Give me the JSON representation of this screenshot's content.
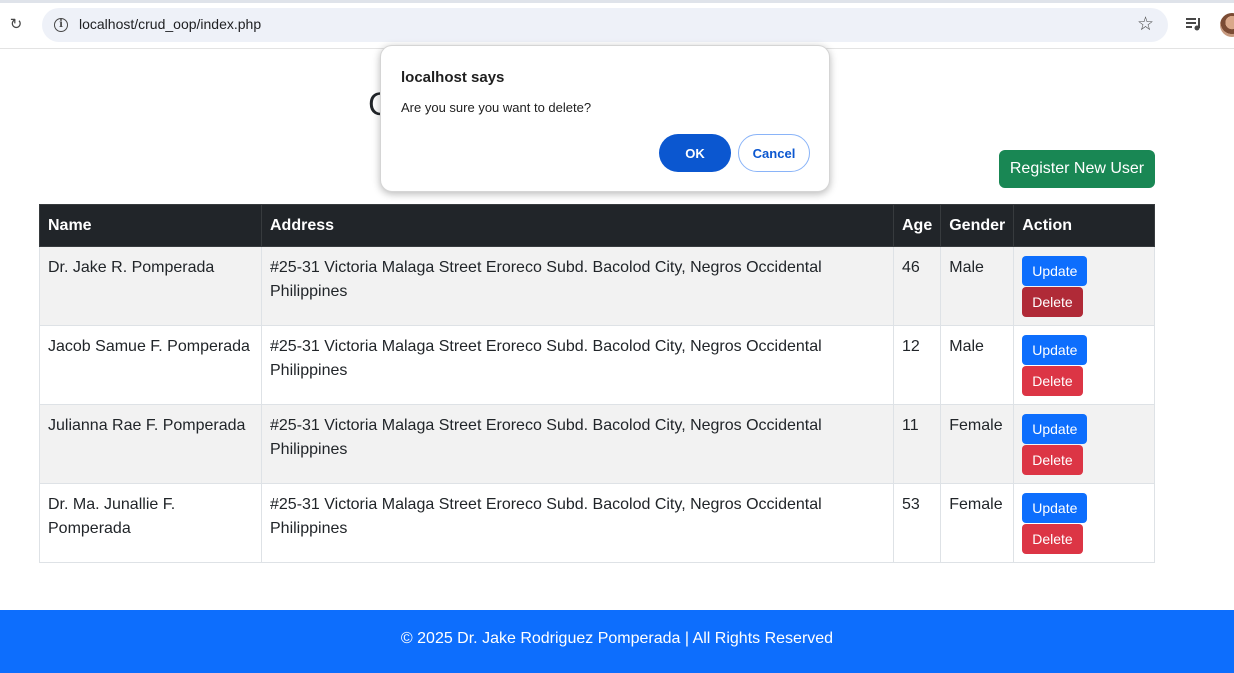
{
  "browser": {
    "url": "localhost/crud_oop/index.php",
    "icons": [
      "reload-icon",
      "site-info-icon",
      "bookmark-star-icon",
      "media-controls-icon",
      "profile-avatar"
    ]
  },
  "page": {
    "title": "CRUD OOP in PHP and MySQL",
    "register_label": "Register New User"
  },
  "table": {
    "headers": [
      "Name",
      "Address",
      "Age",
      "Gender",
      "Action"
    ],
    "rows": [
      {
        "name": "Dr. Jake R. Pomperada",
        "address": "#25-31 Victoria Malaga Street Eroreco Subd. Bacolod City, Negros Occidental Philippines",
        "age": "46",
        "gender": "Male"
      },
      {
        "name": "Jacob Samue F. Pomperada",
        "address": "#25-31 Victoria Malaga Street Eroreco Subd. Bacolod City, Negros Occidental Philippines",
        "age": "12",
        "gender": "Male"
      },
      {
        "name": "Julianna Rae F. Pomperada",
        "address": "#25-31 Victoria Malaga Street Eroreco Subd. Bacolod City, Negros Occidental Philippines",
        "age": "11",
        "gender": "Female"
      },
      {
        "name": "Dr. Ma. Junallie F. Pomperada",
        "address": "#25-31 Victoria Malaga Street Eroreco Subd. Bacolod City, Negros Occidental Philippines",
        "age": "53",
        "gender": "Female"
      }
    ],
    "update_label": "Update",
    "delete_label": "Delete"
  },
  "footer": {
    "text": "© 2025 Dr. Jake Rodriguez Pomperada | All Rights Reserved"
  },
  "dialog": {
    "title": "localhost says",
    "message": "Are you sure you want to delete?",
    "ok_label": "OK",
    "cancel_label": "Cancel"
  },
  "colors": {
    "header_bg": "#212529",
    "success": "#198754",
    "primary": "#0d6efd",
    "danger": "#dc3545",
    "dialog_accent": "#0b57d0"
  }
}
